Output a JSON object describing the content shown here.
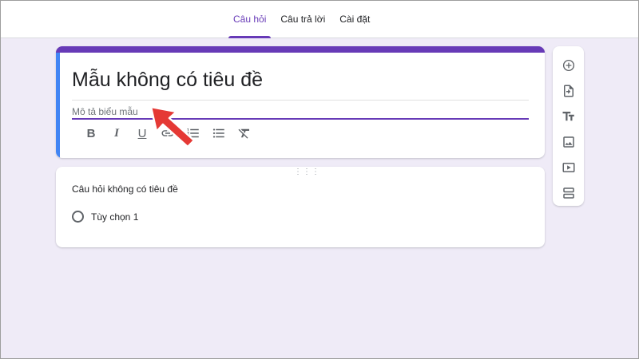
{
  "tabs": [
    {
      "label": "Câu hỏi",
      "active": true
    },
    {
      "label": "Câu trả lời",
      "active": false
    },
    {
      "label": "Cài đặt",
      "active": false
    }
  ],
  "form": {
    "title": "Mẫu không có tiêu đề",
    "description_placeholder": "Mô tả biểu mẫu"
  },
  "toolbar": {
    "bold": "B",
    "italic": "I",
    "underline": "U"
  },
  "question": {
    "title": "Câu hỏi không có tiêu đề",
    "options": [
      "Tùy chọn 1"
    ]
  },
  "side_tools": [
    "add-question-icon",
    "import-questions-icon",
    "add-title-icon",
    "add-image-icon",
    "add-video-icon",
    "add-section-icon"
  ],
  "colors": {
    "accent": "#673ab7",
    "focus": "#4285f4",
    "background": "#efebf7",
    "annotation_arrow": "#e53935"
  }
}
